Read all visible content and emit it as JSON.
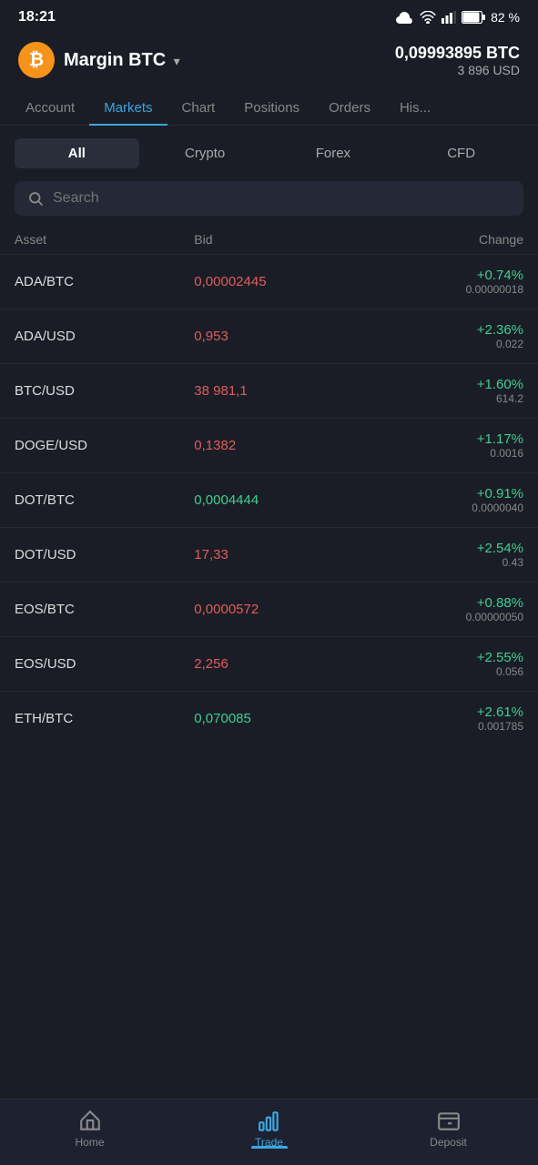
{
  "statusBar": {
    "time": "18:21",
    "battery": "82 %"
  },
  "header": {
    "accountName": "Margin BTC",
    "balanceBTC": "0,09993895 BTC",
    "balanceUSD": "3 896 USD",
    "btcSymbol": "₿"
  },
  "navTabs": [
    {
      "id": "account",
      "label": "Account",
      "active": false
    },
    {
      "id": "markets",
      "label": "Markets",
      "active": true
    },
    {
      "id": "chart",
      "label": "Chart",
      "active": false
    },
    {
      "id": "positions",
      "label": "Positions",
      "active": false
    },
    {
      "id": "orders",
      "label": "Orders",
      "active": false
    },
    {
      "id": "history",
      "label": "His...",
      "active": false
    }
  ],
  "filterButtons": [
    {
      "id": "all",
      "label": "All",
      "active": true
    },
    {
      "id": "crypto",
      "label": "Crypto",
      "active": false
    },
    {
      "id": "forex",
      "label": "Forex",
      "active": false
    },
    {
      "id": "cfd",
      "label": "CFD",
      "active": false
    }
  ],
  "search": {
    "placeholder": "Search"
  },
  "tableHeaders": {
    "asset": "Asset",
    "bid": "Bid",
    "change": "Change"
  },
  "marketRows": [
    {
      "asset": "ADA/BTC",
      "bid": "0,00002445",
      "bidColor": "red",
      "changePct": "+0.74%",
      "changeAbs": "0.00000018"
    },
    {
      "asset": "ADA/USD",
      "bid": "0,953",
      "bidColor": "red",
      "changePct": "+2.36%",
      "changeAbs": "0.022"
    },
    {
      "asset": "BTC/USD",
      "bid": "38 981,1",
      "bidColor": "red",
      "changePct": "+1.60%",
      "changeAbs": "614.2"
    },
    {
      "asset": "DOGE/USD",
      "bid": "0,1382",
      "bidColor": "red",
      "changePct": "+1.17%",
      "changeAbs": "0.0016"
    },
    {
      "asset": "DOT/BTC",
      "bid": "0,0004444",
      "bidColor": "green",
      "changePct": "+0.91%",
      "changeAbs": "0.0000040"
    },
    {
      "asset": "DOT/USD",
      "bid": "17,33",
      "bidColor": "red",
      "changePct": "+2.54%",
      "changeAbs": "0.43"
    },
    {
      "asset": "EOS/BTC",
      "bid": "0,0000572",
      "bidColor": "red",
      "changePct": "+0.88%",
      "changeAbs": "0.00000050"
    },
    {
      "asset": "EOS/USD",
      "bid": "2,256",
      "bidColor": "red",
      "changePct": "+2.55%",
      "changeAbs": "0.056"
    },
    {
      "asset": "ETH/BTC",
      "bid": "0,070085",
      "bidColor": "green",
      "changePct": "+2.61%",
      "changeAbs": "0.001785"
    }
  ],
  "bottomNav": [
    {
      "id": "home",
      "label": "Home",
      "active": false
    },
    {
      "id": "trade",
      "label": "Trade",
      "active": true
    },
    {
      "id": "deposit",
      "label": "Deposit",
      "active": false
    }
  ]
}
